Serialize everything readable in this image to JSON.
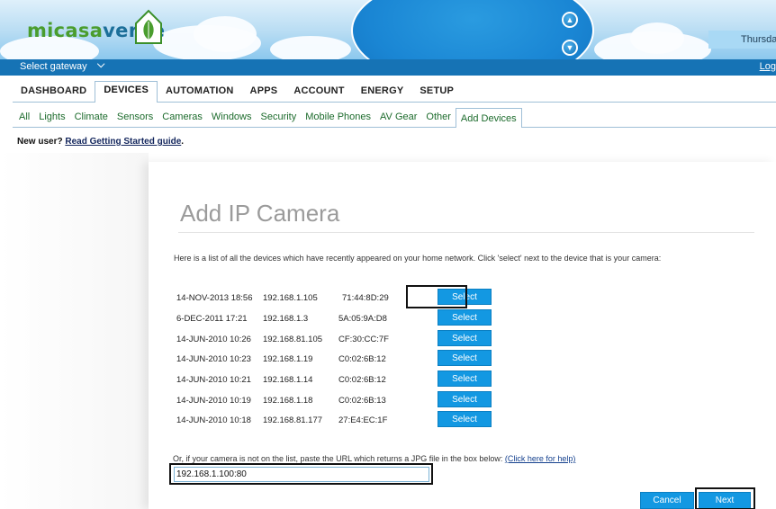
{
  "header": {
    "logo_part1": "micasa",
    "logo_part2": "verde",
    "date_text": "Thursda"
  },
  "gateway_bar": {
    "select_label": "Select gateway",
    "chevron_icon": "chevron-down-icon",
    "logout_label": "Log"
  },
  "main_tabs": [
    {
      "label": "DASHBOARD",
      "active": false
    },
    {
      "label": "DEVICES",
      "active": true
    },
    {
      "label": "AUTOMATION",
      "active": false
    },
    {
      "label": "APPS",
      "active": false
    },
    {
      "label": "ACCOUNT",
      "active": false
    },
    {
      "label": "ENERGY",
      "active": false
    },
    {
      "label": "SETUP",
      "active": false
    }
  ],
  "sub_tabs": [
    {
      "label": "All",
      "active": false
    },
    {
      "label": "Lights",
      "active": false
    },
    {
      "label": "Climate",
      "active": false
    },
    {
      "label": "Sensors",
      "active": false
    },
    {
      "label": "Cameras",
      "active": false
    },
    {
      "label": "Windows",
      "active": false
    },
    {
      "label": "Security",
      "active": false
    },
    {
      "label": "Mobile Phones",
      "active": false
    },
    {
      "label": "AV Gear",
      "active": false
    },
    {
      "label": "Other",
      "active": false
    },
    {
      "label": "Add Devices",
      "active": true
    }
  ],
  "new_user": {
    "prefix": "New user?",
    "link": "Read Getting Started guide",
    "suffix": "."
  },
  "dialog": {
    "title": "Add IP Camera",
    "intro": "Here is a list of all the devices which have recently appeared on your home network. Click 'select' next to the device that is your camera:",
    "select_label": "Select",
    "devices": [
      {
        "date": "14-NOV-2013 18:56",
        "ip": "192.168.1.105",
        "mac": "71:44:8D:29"
      },
      {
        "date": "6-DEC-2011 17:21",
        "ip": "192.168.1.3",
        "mac": "5A:05:9A:D8"
      },
      {
        "date": "14-JUN-2010 10:26",
        "ip": "192.168.81.105",
        "mac": "CF:30:CC:7F"
      },
      {
        "date": "14-JUN-2010 10:23",
        "ip": "192.168.1.19",
        "mac": "C0:02:6B:12"
      },
      {
        "date": "14-JUN-2010 10:21",
        "ip": "192.168.1.14",
        "mac": "C0:02:6B:12"
      },
      {
        "date": "14-JUN-2010 10:19",
        "ip": "192.168.1.18",
        "mac": "C0:02:6B:13"
      },
      {
        "date": "14-JUN-2010 10:18",
        "ip": "192.168.81.177",
        "mac": "27:E4:EC:1F"
      }
    ],
    "or_text": "Or, if your camera is not on the list, paste the URL which returns a JPG file in the box below:",
    "help_link": "(Click here for help)",
    "url_value": "192.168.1.100:80",
    "cancel_label": "Cancel",
    "next_label": "Next"
  }
}
